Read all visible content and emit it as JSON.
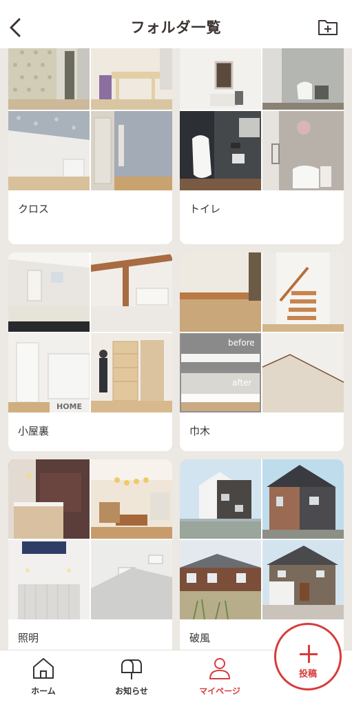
{
  "header": {
    "title": "フォルダ一覧",
    "back_icon": "chevron-left-icon",
    "new_folder_icon": "folder-add-icon"
  },
  "folders": [
    {
      "name": "クロス"
    },
    {
      "name": "トイレ"
    },
    {
      "name": "小屋裏"
    },
    {
      "name": "巾木",
      "overlay": {
        "before": "before",
        "after": "after"
      }
    },
    {
      "name": "照明"
    },
    {
      "name": "破風"
    }
  ],
  "tabbar": {
    "home": "ホーム",
    "notice": "お知らせ",
    "mypage": "マイページ",
    "post": "投稿",
    "active_color": "#d93a3a"
  }
}
